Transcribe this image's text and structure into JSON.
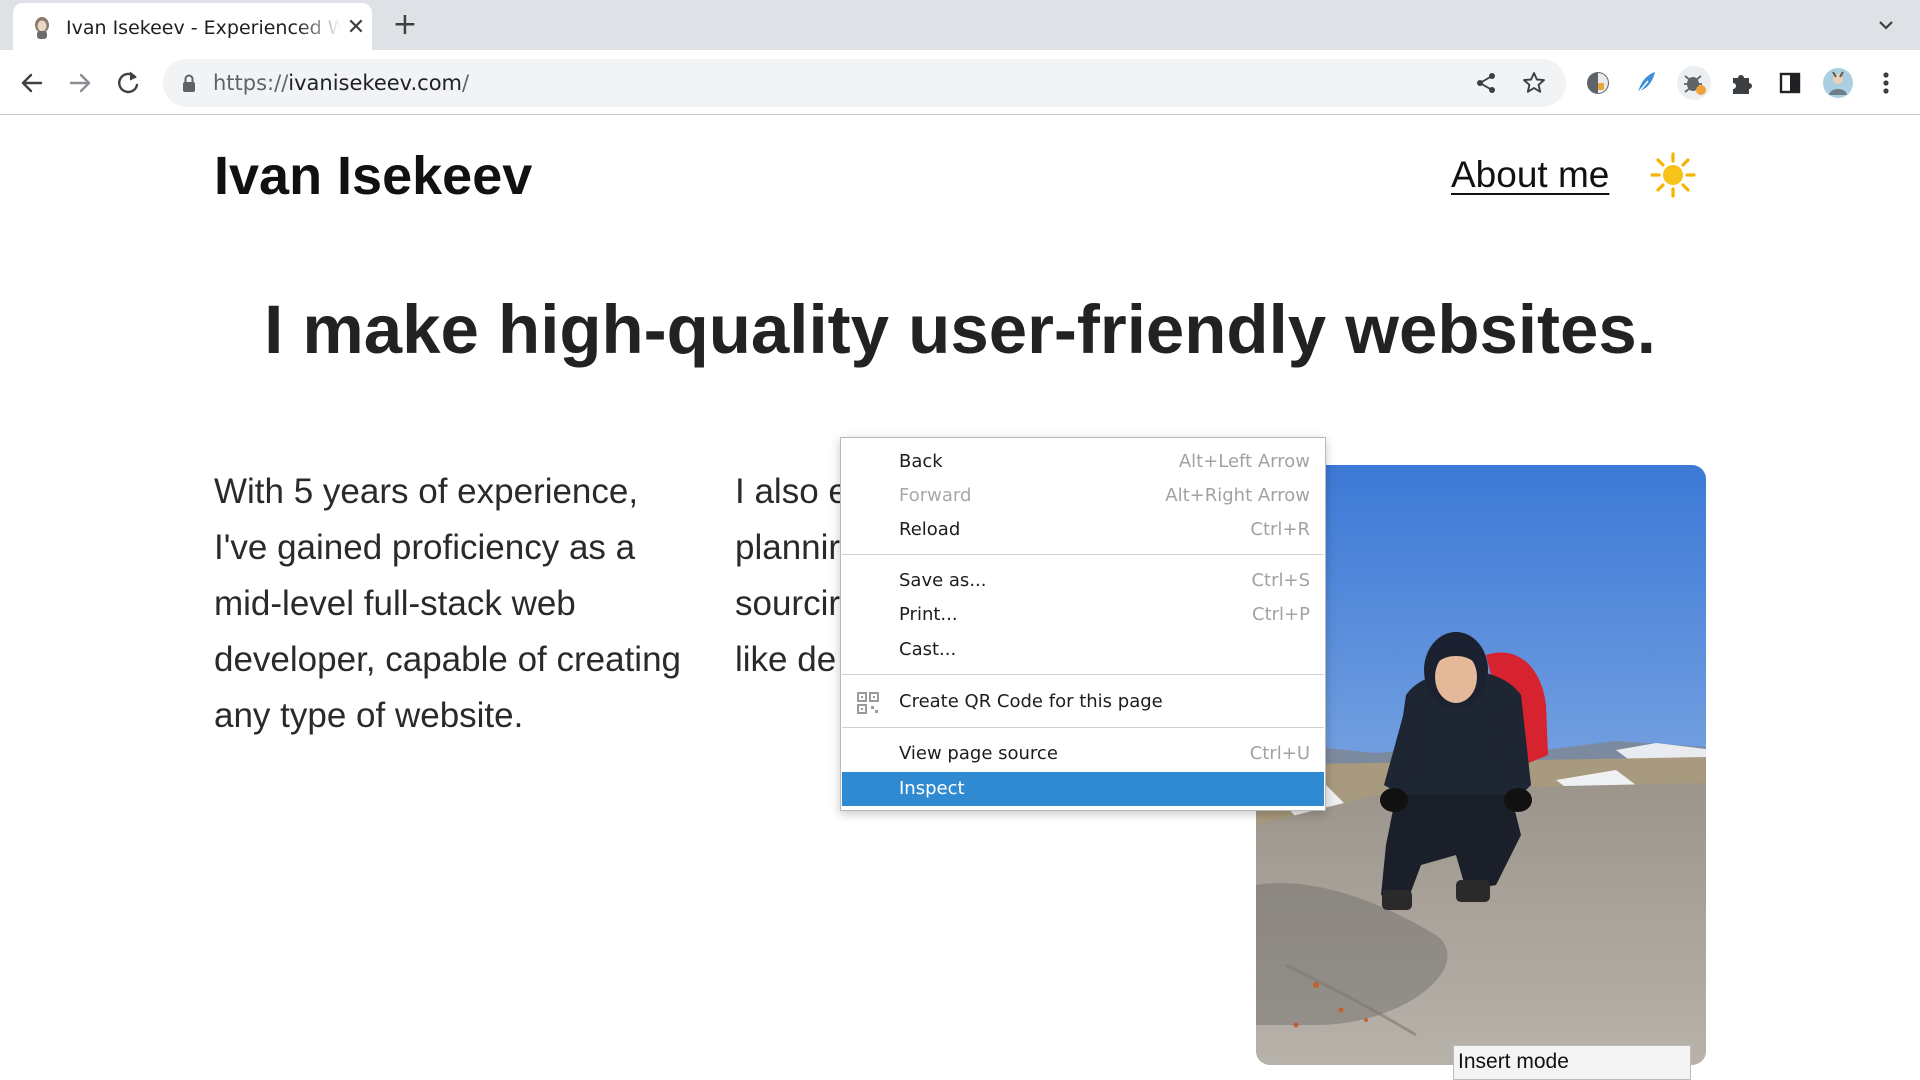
{
  "browser": {
    "tab": {
      "title": "Ivan Isekeev - Experienced Web Developer",
      "close_icon": "close-icon",
      "favicon": "avatar-favicon"
    },
    "new_tab_label": "+",
    "address": {
      "scheme": "https://",
      "host": "ivanisekeev.com",
      "path": "/"
    }
  },
  "page": {
    "site_title": "Ivan Isekeev",
    "nav": {
      "about": "About me"
    },
    "theme_icon": "sun-icon",
    "headline": "I make high-quality user-friendly websites.",
    "intro_lines": [
      "With 5 years of experience,",
      "I've gained proficiency as a",
      "mid-level full-stack web",
      "developer, capable of creating",
      "any type of website."
    ],
    "second_column_lines": [
      "I also e",
      "plannir",
      "sourcir",
      "like de"
    ]
  },
  "context_menu": {
    "items": [
      {
        "label": "Back",
        "shortcut": "Alt+Left Arrow"
      },
      {
        "label": "Forward",
        "shortcut": "Alt+Right Arrow",
        "disabled": true
      },
      {
        "label": "Reload",
        "shortcut": "Ctrl+R"
      },
      {
        "label": "Save as...",
        "shortcut": "Ctrl+S"
      },
      {
        "label": "Print...",
        "shortcut": "Ctrl+P"
      },
      {
        "label": "Cast..."
      },
      {
        "label": "Create QR Code for this page",
        "icon": "qr-code-icon"
      },
      {
        "label": "View page source",
        "shortcut": "Ctrl+U"
      },
      {
        "label": "Inspect",
        "highlighted": true
      }
    ],
    "highlight_color": "#308ad1"
  },
  "status": {
    "mode_indicator": "Insert mode"
  }
}
